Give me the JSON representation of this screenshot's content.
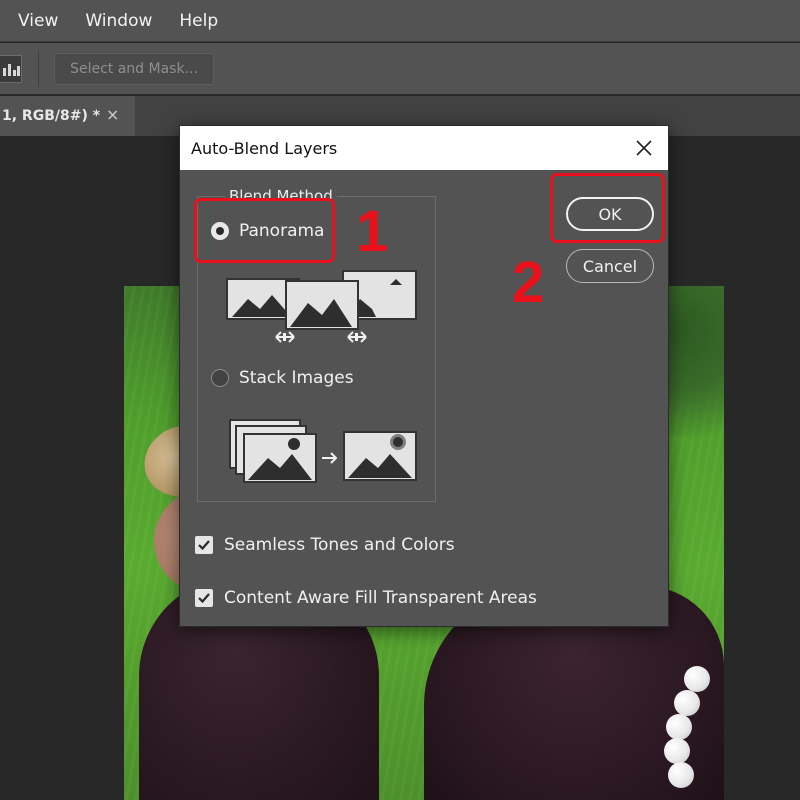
{
  "menu": [
    "View",
    "Window",
    "Help"
  ],
  "options_bar": {
    "select_mask_label": "Select and Mask..."
  },
  "document_tab": {
    "title": "1, RGB/8#) *",
    "close_label": "×"
  },
  "dialog": {
    "title": "Auto-Blend Layers",
    "close_label": "✕",
    "blend_method": {
      "legend": "Blend Method",
      "options": [
        {
          "label": "Panorama",
          "selected": true
        },
        {
          "label": "Stack Images",
          "selected": false
        }
      ]
    },
    "checkboxes": [
      {
        "label": "Seamless Tones and Colors",
        "checked": true
      },
      {
        "label": "Content Aware Fill Transparent Areas",
        "checked": true
      }
    ],
    "buttons": {
      "ok": "OK",
      "cancel": "Cancel"
    }
  },
  "annotations": {
    "step1": "1",
    "step2": "2",
    "color": "#e8101a"
  },
  "colors": {
    "panel": "#535353",
    "workspace": "#282828",
    "title_bar": "#ffffff"
  }
}
